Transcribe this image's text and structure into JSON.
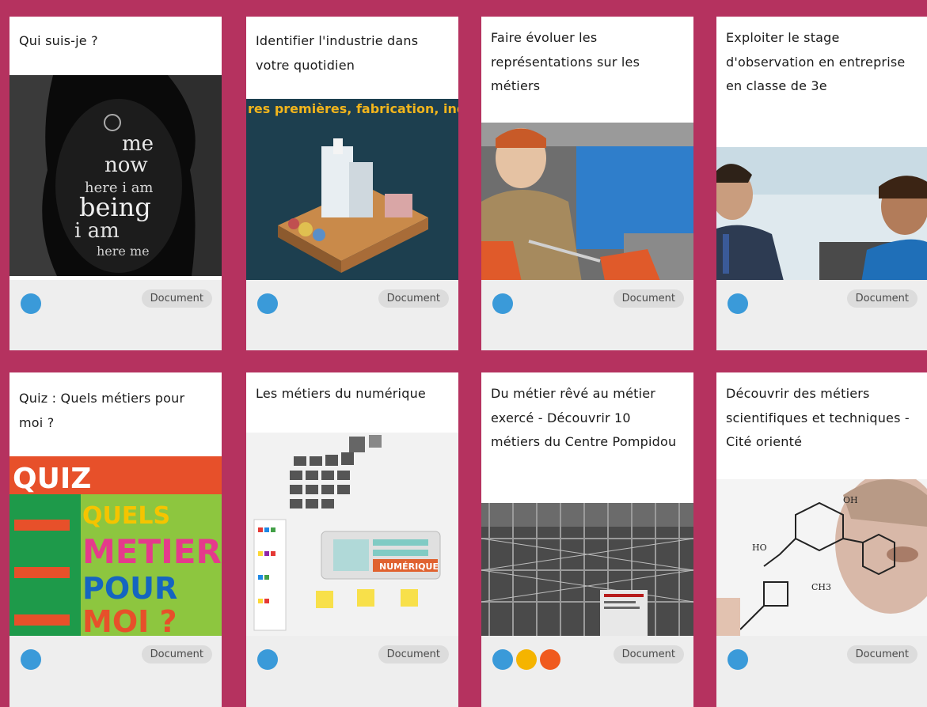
{
  "colors": {
    "background": "#b5325f",
    "card": "#ffffff",
    "footer": "#eeeeee",
    "badge": "#dcdcdc",
    "dot_blue": "#3a9ad9",
    "dot_yellow": "#f5b400",
    "dot_orange": "#f05a1e"
  },
  "cards": [
    {
      "title": "Qui suis-je ?",
      "badge": "Document",
      "dots": [
        "#3a9ad9"
      ],
      "image": "word-art-portrait"
    },
    {
      "title": "Identifier l'industrie dans votre quotidien",
      "badge": "Document",
      "dots": [
        "#3a9ad9"
      ],
      "image": "industry-illustration",
      "image_caption": "res premières, fabrication, indu"
    },
    {
      "title": "Faire évoluer les représentations sur les métiers",
      "badge": "Document",
      "dots": [
        "#3a9ad9"
      ],
      "image": "welder-photo"
    },
    {
      "title": "Exploiter le stage d'observation en entreprise en classe de 3e",
      "badge": "Document",
      "dots": [
        "#3a9ad9"
      ],
      "image": "office-photo"
    },
    {
      "title": "Quiz : Quels métiers pour moi ?",
      "badge": "Document",
      "dots": [
        "#3a9ad9"
      ],
      "image": "quiz-poster",
      "quiz": {
        "header": "QUIZ",
        "w1": "QUELS",
        "w2": "METIERS",
        "w3": "POUR",
        "w4": "MOI ?"
      }
    },
    {
      "title": "Les métiers du numérique",
      "badge": "Document",
      "dots": [
        "#3a9ad9"
      ],
      "image": "digital-board",
      "image_caption": "NUMÉRIQUE"
    },
    {
      "title": "Du métier rêvé au métier exercé - Découvrir 10 métiers du Centre Pompidou",
      "badge": "Document",
      "dots": [
        "#3a9ad9",
        "#f5b400",
        "#f05a1e"
      ],
      "image": "pompidou-photo"
    },
    {
      "title": "Découvrir des métiers scientifiques et techniques - Cité orienté",
      "badge": "Document",
      "dots": [
        "#3a9ad9"
      ],
      "image": "chemistry-photo"
    }
  ]
}
